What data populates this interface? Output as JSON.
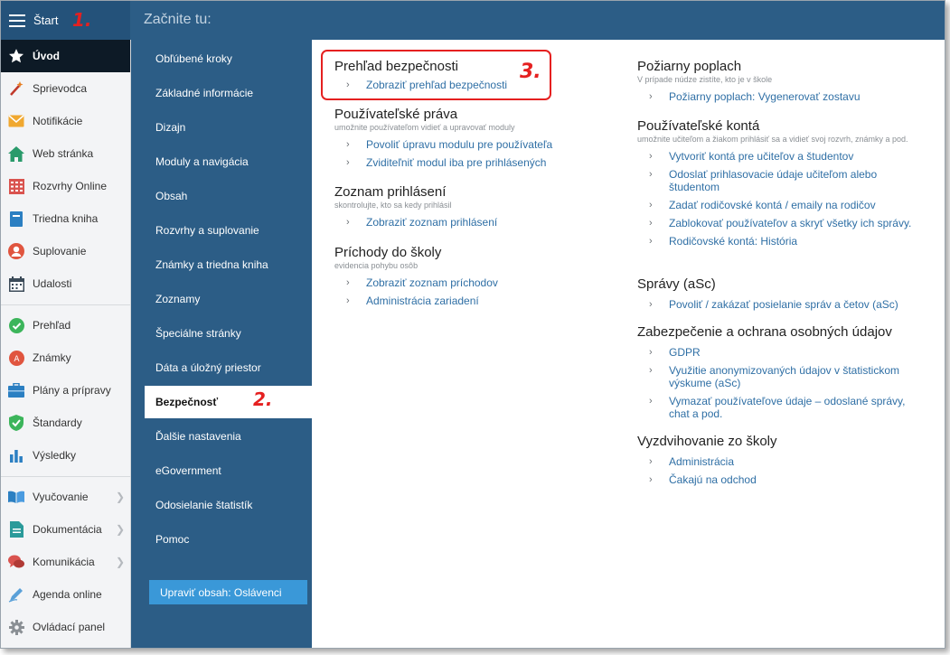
{
  "header": {
    "start_label": "Štart",
    "title": "Začnite tu:",
    "annotation_1": "1.",
    "annotation_2": "2.",
    "annotation_3": "3."
  },
  "sidebar": {
    "items": [
      {
        "label": "Úvod",
        "icon": "star-icon",
        "active": true
      },
      {
        "label": "Sprievodca",
        "icon": "magic-wand-icon"
      },
      {
        "label": "Notifikácie",
        "icon": "envelope-icon"
      },
      {
        "label": "Web stránka",
        "icon": "house-icon"
      },
      {
        "label": "Rozvrhy Online",
        "icon": "timetable-icon"
      },
      {
        "label": "Triedna kniha",
        "icon": "book-icon"
      },
      {
        "label": "Suplovanie",
        "icon": "substitute-person-icon"
      },
      {
        "label": "Udalosti",
        "icon": "calendar-icon"
      },
      {
        "label": "Prehľad",
        "icon": "check-circle-icon"
      },
      {
        "label": "Známky",
        "icon": "grades-icon"
      },
      {
        "label": "Plány a prípravy",
        "icon": "briefcase-icon"
      },
      {
        "label": "Štandardy",
        "icon": "shield-check-icon"
      },
      {
        "label": "Výsledky",
        "icon": "bar-chart-icon"
      },
      {
        "label": "Vyučovanie",
        "icon": "open-book-icon",
        "chevron": true
      },
      {
        "label": "Dokumentácia",
        "icon": "document-icon",
        "chevron": true
      },
      {
        "label": "Komunikácia",
        "icon": "chat-icon",
        "chevron": true
      },
      {
        "label": "Agenda online",
        "icon": "pen-icon"
      },
      {
        "label": "Ovládací panel",
        "icon": "gear-icon"
      }
    ]
  },
  "midnav": {
    "items": [
      {
        "label": "Obľúbené kroky"
      },
      {
        "label": "Základné informácie"
      },
      {
        "label": "Dizajn"
      },
      {
        "label": "Moduly a navigácia"
      },
      {
        "label": "Obsah"
      },
      {
        "label": "Rozvrhy a suplovanie"
      },
      {
        "label": "Známky a triedna kniha"
      },
      {
        "label": "Zoznamy"
      },
      {
        "label": "Špeciálne stránky"
      },
      {
        "label": "Dáta a úložný priestor"
      },
      {
        "label": "Bezpečnosť",
        "active": true
      },
      {
        "label": "Ďalšie nastavenia"
      },
      {
        "label": "eGovernment"
      },
      {
        "label": "Odosielanie štatistík"
      },
      {
        "label": "Pomoc"
      }
    ],
    "button_label": "Upraviť obsah: Oslávenci"
  },
  "content": {
    "left": [
      {
        "title": "Prehľad bezpečnosti",
        "subtitle": "",
        "links": [
          "Zobraziť prehľad bezpečnosti"
        ]
      },
      {
        "title": "Používateľské práva",
        "subtitle": "umožnite používateľom vidieť a upravovať moduly",
        "links": [
          "Povoliť úpravu modulu pre používateľa",
          "Zviditeľniť modul iba pre prihlásených"
        ]
      },
      {
        "title": "Zoznam prihlásení",
        "subtitle": "skontrolujte, kto sa kedy prihlásil",
        "links": [
          "Zobraziť zoznam prihlásení"
        ]
      },
      {
        "title": "Príchody do školy",
        "subtitle": "evidencia pohybu osôb",
        "links": [
          "Zobraziť zoznam príchodov",
          "Administrácia zariadení"
        ]
      }
    ],
    "right": [
      {
        "title": "Požiarny poplach",
        "subtitle": "V prípade núdze zistíte, kto je v škole",
        "links": [
          "Požiarny poplach: Vygenerovať zostavu"
        ]
      },
      {
        "title": "Používateľské kontá",
        "subtitle": "umožnite učiteľom a žiakom prihlásiť sa a vidieť svoj rozvrh, známky a pod.",
        "links": [
          "Vytvoriť kontá pre učiteľov a študentov",
          "Odoslať prihlasovacie údaje učiteľom alebo študentom",
          "Zadať rodičovské kontá / emaily na rodičov",
          "Zablokovať používateľov a skryť všetky ich správy.",
          "Rodičovské kontá: História"
        ]
      },
      {
        "title": "Správy (aSc)",
        "subtitle": "",
        "links": [
          "Povoliť / zakázať posielanie správ a četov (aSc)"
        ]
      },
      {
        "title": "Zabezpečenie a ochrana osobných údajov",
        "subtitle": "",
        "links": [
          "GDPR",
          "Využitie anonymizovaných údajov v štatistickom výskume (aSc)",
          "Vymazať používateľove údaje – odoslané správy, chat a pod."
        ]
      },
      {
        "title": "Vyzdvihovanie zo školy",
        "subtitle": "",
        "links": [
          "Administrácia",
          "Čakajú na odchod"
        ]
      }
    ]
  },
  "colors": {
    "header_bg": "#2c5d86",
    "nav_bg": "#2c5d86",
    "active_sidebar_bg": "#0d1a26",
    "link": "#2f6fa5",
    "annotation": "#e52020",
    "button": "#3a98d8"
  }
}
